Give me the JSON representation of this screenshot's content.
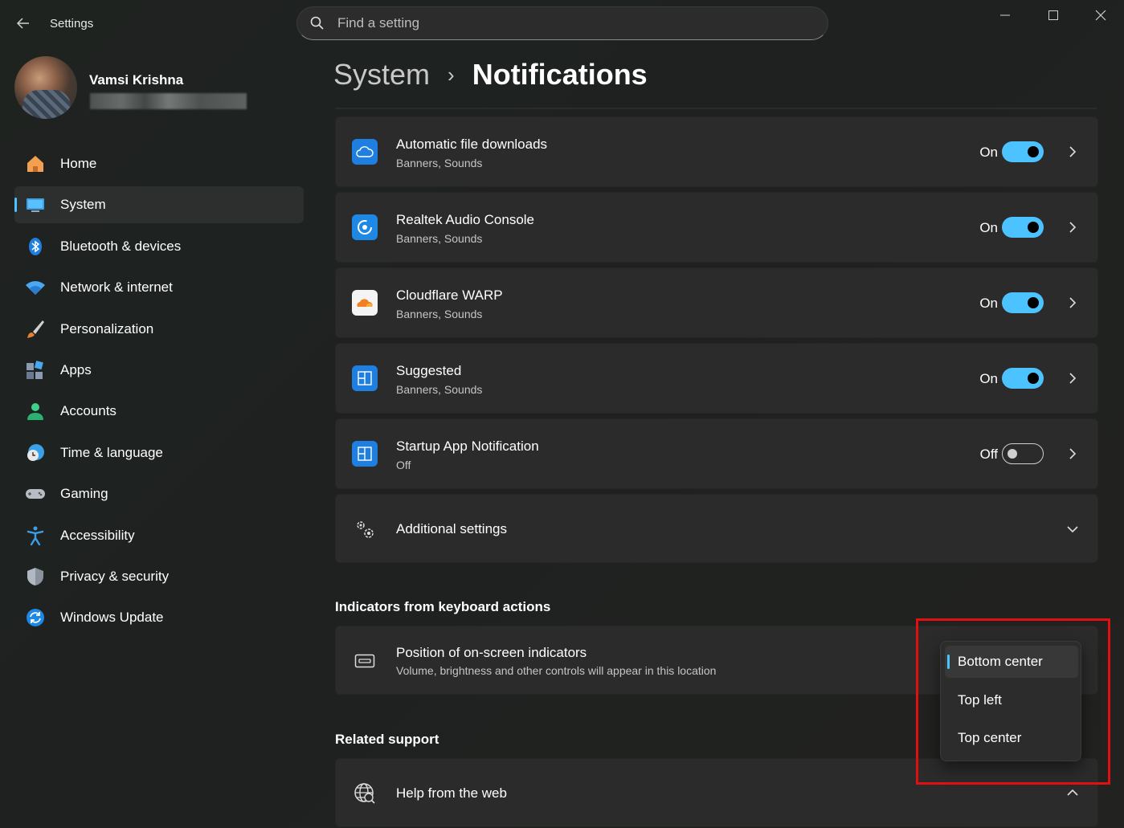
{
  "window": {
    "app_title": "Settings",
    "search_placeholder": "Find a setting"
  },
  "profile": {
    "name": "Vamsi Krishna"
  },
  "sidebar": {
    "items": [
      {
        "label": "Home",
        "icon": "home-icon"
      },
      {
        "label": "System",
        "icon": "system-icon",
        "active": true
      },
      {
        "label": "Bluetooth & devices",
        "icon": "bluetooth-icon"
      },
      {
        "label": "Network & internet",
        "icon": "network-icon"
      },
      {
        "label": "Personalization",
        "icon": "brush-icon"
      },
      {
        "label": "Apps",
        "icon": "apps-icon"
      },
      {
        "label": "Accounts",
        "icon": "accounts-icon"
      },
      {
        "label": "Time & language",
        "icon": "clock-globe-icon"
      },
      {
        "label": "Gaming",
        "icon": "gamepad-icon"
      },
      {
        "label": "Accessibility",
        "icon": "accessibility-icon"
      },
      {
        "label": "Privacy & security",
        "icon": "shield-icon"
      },
      {
        "label": "Windows Update",
        "icon": "update-icon"
      }
    ]
  },
  "breadcrumb": {
    "parent": "System",
    "separator": "›",
    "current": "Notifications"
  },
  "apps": [
    {
      "title": "Automatic file downloads",
      "sub": "Banners, Sounds",
      "state": "On",
      "on": true,
      "icon": "cloud-icon"
    },
    {
      "title": "Realtek Audio Console",
      "sub": "Banners, Sounds",
      "state": "On",
      "on": true,
      "icon": "realtek-icon"
    },
    {
      "title": "Cloudflare WARP",
      "sub": "Banners, Sounds",
      "state": "On",
      "on": true,
      "icon": "cloudflare-icon"
    },
    {
      "title": "Suggested",
      "sub": "Banners, Sounds",
      "state": "On",
      "on": true,
      "icon": "suggested-icon"
    },
    {
      "title": "Startup App Notification",
      "sub": "Off",
      "state": "Off",
      "on": false,
      "icon": "startup-icon"
    }
  ],
  "additional_settings": {
    "label": "Additional settings"
  },
  "indicators_section": {
    "heading": "Indicators from keyboard actions",
    "title": "Position of on-screen indicators",
    "sub": "Volume, brightness and other controls will appear in this location"
  },
  "dropdown": {
    "options": [
      "Bottom center",
      "Top left",
      "Top center"
    ],
    "selected": "Bottom center"
  },
  "related_support": {
    "heading": "Related support",
    "help_label": "Help from the web"
  },
  "colors": {
    "accent": "#4cc2ff",
    "highlight": "#e01010"
  }
}
